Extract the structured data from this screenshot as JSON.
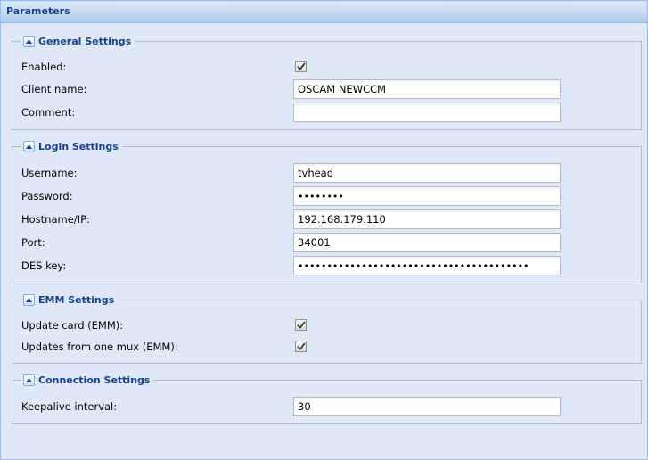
{
  "panel": {
    "title": "Parameters"
  },
  "general": {
    "title": "General Settings",
    "enabled": {
      "label": "Enabled:",
      "checked": true
    },
    "client_name": {
      "label": "Client name:",
      "value": "OSCAM NEWCCM"
    },
    "comment": {
      "label": "Comment:",
      "value": ""
    }
  },
  "login": {
    "title": "Login Settings",
    "username": {
      "label": "Username:",
      "value": "tvhead"
    },
    "password": {
      "label": "Password:",
      "value": "••••••••"
    },
    "hostname": {
      "label": "Hostname/IP:",
      "value": "192.168.179.110"
    },
    "port": {
      "label": "Port:",
      "value": "34001"
    },
    "des_key": {
      "label": "DES key:",
      "value": "••••••••••••••••••••••••••••••••••••••••"
    }
  },
  "emm": {
    "title": "EMM Settings",
    "update_card": {
      "label": "Update card (EMM):",
      "checked": true
    },
    "updates_one_mux": {
      "label": "Updates from one mux (EMM):",
      "checked": true
    }
  },
  "connection": {
    "title": "Connection Settings",
    "keepalive": {
      "label": "Keepalive interval:",
      "value": "30"
    }
  },
  "icons": {
    "collapse": "collapse-up-icon",
    "check": "checkmark-icon"
  }
}
